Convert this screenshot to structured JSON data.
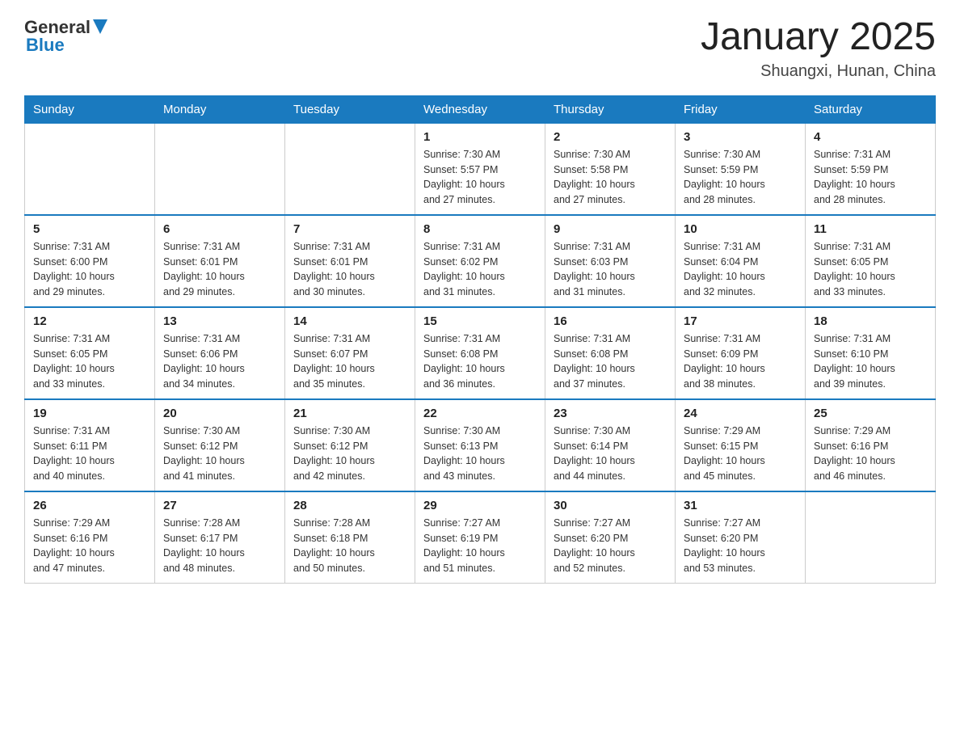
{
  "header": {
    "logo_general": "General",
    "logo_blue": "Blue",
    "title": "January 2025",
    "location": "Shuangxi, Hunan, China"
  },
  "days_of_week": [
    "Sunday",
    "Monday",
    "Tuesday",
    "Wednesday",
    "Thursday",
    "Friday",
    "Saturday"
  ],
  "weeks": [
    [
      {
        "day": "",
        "info": ""
      },
      {
        "day": "",
        "info": ""
      },
      {
        "day": "",
        "info": ""
      },
      {
        "day": "1",
        "info": "Sunrise: 7:30 AM\nSunset: 5:57 PM\nDaylight: 10 hours\nand 27 minutes."
      },
      {
        "day": "2",
        "info": "Sunrise: 7:30 AM\nSunset: 5:58 PM\nDaylight: 10 hours\nand 27 minutes."
      },
      {
        "day": "3",
        "info": "Sunrise: 7:30 AM\nSunset: 5:59 PM\nDaylight: 10 hours\nand 28 minutes."
      },
      {
        "day": "4",
        "info": "Sunrise: 7:31 AM\nSunset: 5:59 PM\nDaylight: 10 hours\nand 28 minutes."
      }
    ],
    [
      {
        "day": "5",
        "info": "Sunrise: 7:31 AM\nSunset: 6:00 PM\nDaylight: 10 hours\nand 29 minutes."
      },
      {
        "day": "6",
        "info": "Sunrise: 7:31 AM\nSunset: 6:01 PM\nDaylight: 10 hours\nand 29 minutes."
      },
      {
        "day": "7",
        "info": "Sunrise: 7:31 AM\nSunset: 6:01 PM\nDaylight: 10 hours\nand 30 minutes."
      },
      {
        "day": "8",
        "info": "Sunrise: 7:31 AM\nSunset: 6:02 PM\nDaylight: 10 hours\nand 31 minutes."
      },
      {
        "day": "9",
        "info": "Sunrise: 7:31 AM\nSunset: 6:03 PM\nDaylight: 10 hours\nand 31 minutes."
      },
      {
        "day": "10",
        "info": "Sunrise: 7:31 AM\nSunset: 6:04 PM\nDaylight: 10 hours\nand 32 minutes."
      },
      {
        "day": "11",
        "info": "Sunrise: 7:31 AM\nSunset: 6:05 PM\nDaylight: 10 hours\nand 33 minutes."
      }
    ],
    [
      {
        "day": "12",
        "info": "Sunrise: 7:31 AM\nSunset: 6:05 PM\nDaylight: 10 hours\nand 33 minutes."
      },
      {
        "day": "13",
        "info": "Sunrise: 7:31 AM\nSunset: 6:06 PM\nDaylight: 10 hours\nand 34 minutes."
      },
      {
        "day": "14",
        "info": "Sunrise: 7:31 AM\nSunset: 6:07 PM\nDaylight: 10 hours\nand 35 minutes."
      },
      {
        "day": "15",
        "info": "Sunrise: 7:31 AM\nSunset: 6:08 PM\nDaylight: 10 hours\nand 36 minutes."
      },
      {
        "day": "16",
        "info": "Sunrise: 7:31 AM\nSunset: 6:08 PM\nDaylight: 10 hours\nand 37 minutes."
      },
      {
        "day": "17",
        "info": "Sunrise: 7:31 AM\nSunset: 6:09 PM\nDaylight: 10 hours\nand 38 minutes."
      },
      {
        "day": "18",
        "info": "Sunrise: 7:31 AM\nSunset: 6:10 PM\nDaylight: 10 hours\nand 39 minutes."
      }
    ],
    [
      {
        "day": "19",
        "info": "Sunrise: 7:31 AM\nSunset: 6:11 PM\nDaylight: 10 hours\nand 40 minutes."
      },
      {
        "day": "20",
        "info": "Sunrise: 7:30 AM\nSunset: 6:12 PM\nDaylight: 10 hours\nand 41 minutes."
      },
      {
        "day": "21",
        "info": "Sunrise: 7:30 AM\nSunset: 6:12 PM\nDaylight: 10 hours\nand 42 minutes."
      },
      {
        "day": "22",
        "info": "Sunrise: 7:30 AM\nSunset: 6:13 PM\nDaylight: 10 hours\nand 43 minutes."
      },
      {
        "day": "23",
        "info": "Sunrise: 7:30 AM\nSunset: 6:14 PM\nDaylight: 10 hours\nand 44 minutes."
      },
      {
        "day": "24",
        "info": "Sunrise: 7:29 AM\nSunset: 6:15 PM\nDaylight: 10 hours\nand 45 minutes."
      },
      {
        "day": "25",
        "info": "Sunrise: 7:29 AM\nSunset: 6:16 PM\nDaylight: 10 hours\nand 46 minutes."
      }
    ],
    [
      {
        "day": "26",
        "info": "Sunrise: 7:29 AM\nSunset: 6:16 PM\nDaylight: 10 hours\nand 47 minutes."
      },
      {
        "day": "27",
        "info": "Sunrise: 7:28 AM\nSunset: 6:17 PM\nDaylight: 10 hours\nand 48 minutes."
      },
      {
        "day": "28",
        "info": "Sunrise: 7:28 AM\nSunset: 6:18 PM\nDaylight: 10 hours\nand 50 minutes."
      },
      {
        "day": "29",
        "info": "Sunrise: 7:27 AM\nSunset: 6:19 PM\nDaylight: 10 hours\nand 51 minutes."
      },
      {
        "day": "30",
        "info": "Sunrise: 7:27 AM\nSunset: 6:20 PM\nDaylight: 10 hours\nand 52 minutes."
      },
      {
        "day": "31",
        "info": "Sunrise: 7:27 AM\nSunset: 6:20 PM\nDaylight: 10 hours\nand 53 minutes."
      },
      {
        "day": "",
        "info": ""
      }
    ]
  ]
}
